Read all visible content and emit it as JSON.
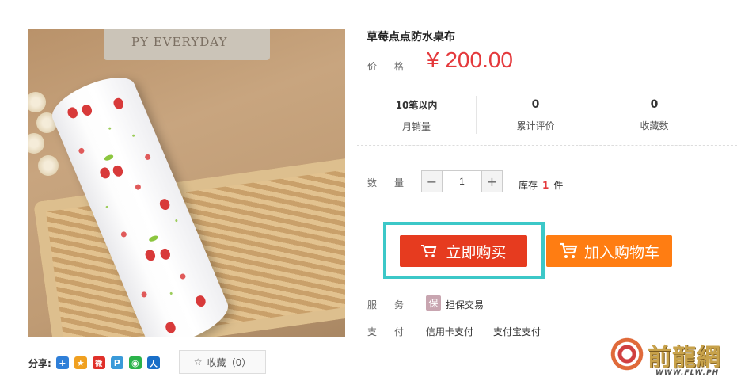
{
  "product": {
    "title": "草莓点点防水桌布",
    "image_text": "PY EVERYDAY",
    "price_label": "价格",
    "price": "¥ 200.00"
  },
  "stats": [
    {
      "value": "10笔以内",
      "label": "月销量"
    },
    {
      "value": "0",
      "label": "累计评价"
    },
    {
      "value": "0",
      "label": "收藏数"
    }
  ],
  "quantity": {
    "label": "数量",
    "minus": "−",
    "value": "1",
    "plus": "+",
    "stock_prefix": "库存",
    "stock_count": "1",
    "stock_unit": "件"
  },
  "actions": {
    "buy_now": "立即购买",
    "add_to_cart": "加入购物车"
  },
  "service": {
    "label": "服务",
    "badge": "保",
    "text": "担保交易"
  },
  "payment": {
    "label": "支付",
    "methods": [
      "信用卡支付",
      "支付宝支付"
    ]
  },
  "share": {
    "label": "分享:",
    "icons": [
      {
        "name": "share-plus-icon",
        "glyph": "+",
        "color": "#2f7fd8"
      },
      {
        "name": "qzone-icon",
        "glyph": "★",
        "color": "#f0a020"
      },
      {
        "name": "weibo-icon",
        "glyph": "微",
        "color": "#e0302a"
      },
      {
        "name": "tencent-weibo-icon",
        "glyph": "P",
        "color": "#3a9ad9"
      },
      {
        "name": "wechat-icon",
        "glyph": "◉",
        "color": "#2bb34a"
      },
      {
        "name": "renren-icon",
        "glyph": "人",
        "color": "#1a6fc8"
      }
    ]
  },
  "favorite": {
    "icon": "☆",
    "label": "收藏（0）"
  },
  "watermark": {
    "title": "前龍網",
    "url": "WWW.FLW.PH"
  },
  "colors": {
    "price_red": "#e4393c",
    "buy_button": "#e63b1f",
    "cart_button": "#ff7d12",
    "highlight": "#3cc8c8"
  }
}
